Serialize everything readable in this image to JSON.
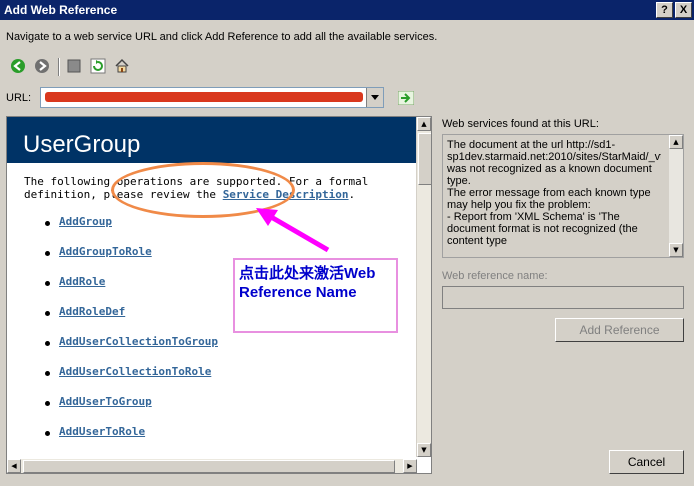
{
  "window": {
    "title": "Add Web Reference",
    "help_label": "?",
    "close_label": "X"
  },
  "instructions": "Navigate to a web service URL and click Add Reference to add all the available services.",
  "url": {
    "label": "URL:",
    "value": ""
  },
  "page": {
    "title": "UserGroup",
    "intro_prefix": "The following operations are supported. For a formal definition, please review the ",
    "service_description_link": "Service Description",
    "intro_suffix": ".",
    "operations": [
      "AddGroup",
      "AddGroupToRole",
      "AddRole",
      "AddRoleDef",
      "AddUserCollectionToGroup",
      "AddUserCollectionToRole",
      "AddUserToGroup",
      "AddUserToRole"
    ]
  },
  "annotation": {
    "callout_text": "点击此处来激活Web Reference Name",
    "colors": {
      "highlight": "#f08a48",
      "arrow": "#ff00ff",
      "callout_text": "#0000cc"
    }
  },
  "services": {
    "label": "Web services found at this URL:",
    "text": "The document at the url http://sd1-sp1dev.starmaid.net:2010/sites/StarMaid/_vti_bin/UserGroup.asmx was not recognized as a known document type.\nThe error message from each known type may help you fix the problem:\n- Report from 'XML Schema' is 'The document format is not recognized (the content type"
  },
  "reference": {
    "label": "Web reference name:",
    "value": "",
    "add_button": "Add Reference"
  },
  "cancel_button": "Cancel",
  "toolbar_icons": [
    "back-icon",
    "forward-icon",
    "stop-icon",
    "refresh-icon",
    "home-icon"
  ]
}
